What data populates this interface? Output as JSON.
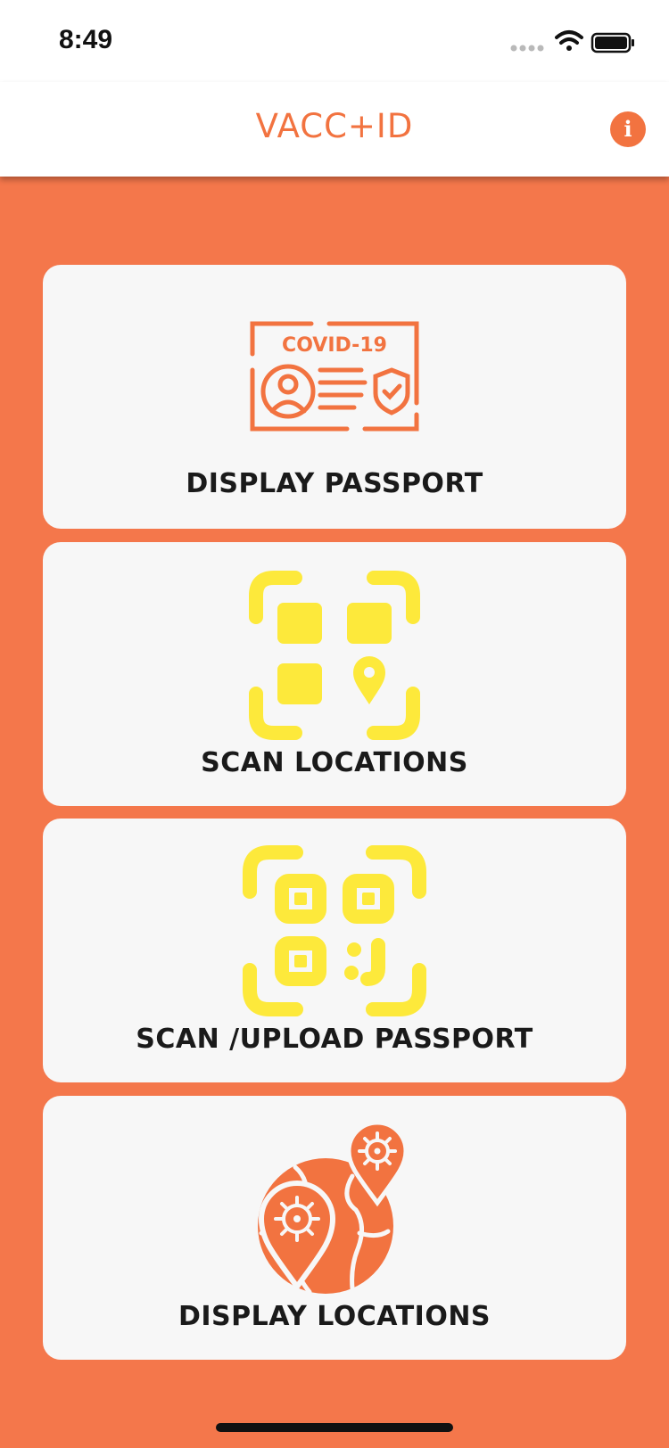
{
  "status_bar": {
    "time": "8:49"
  },
  "header": {
    "title": "VACC+ID",
    "info_icon": "info-icon"
  },
  "cards": [
    {
      "label": "DISPLAY PASSPORT",
      "icon": "covid-passport-icon",
      "icon_text": "COVID-19"
    },
    {
      "label": "SCAN LOCATIONS",
      "icon": "qr-location-scan-icon"
    },
    {
      "label": "SCAN /UPLOAD PASSPORT",
      "icon": "qr-code-scan-icon"
    },
    {
      "label": "DISPLAY LOCATIONS",
      "icon": "globe-virus-pins-icon"
    }
  ],
  "colors": {
    "brand_orange": "#f27340",
    "background": "#f4774b",
    "card": "#f7f7f7",
    "qr_yellow": "#fde93b"
  }
}
